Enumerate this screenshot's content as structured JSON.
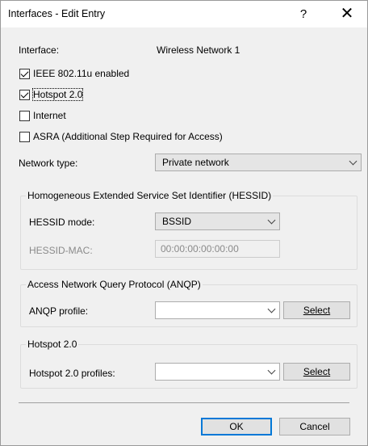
{
  "window": {
    "title": "Interfaces - Edit Entry",
    "help_glyph": "?",
    "close_glyph": "✕"
  },
  "interface": {
    "label": "Interface:",
    "value": "Wireless Network 1"
  },
  "checkboxes": [
    {
      "label": "IEEE 802.11u enabled",
      "checked": true
    },
    {
      "label": "Hotspot 2.0",
      "checked": true
    },
    {
      "label": "Internet",
      "checked": false
    },
    {
      "label": "ASRA (Additional Step Required for Access)",
      "checked": false
    }
  ],
  "network_type": {
    "label": "Network type:",
    "value": "Private network"
  },
  "hessid_group": {
    "title": "Homogeneous Extended Service Set Identifier (HESSID)",
    "mode_label": "HESSID mode:",
    "mode_value": "BSSID",
    "mac_label": "HESSID-MAC:",
    "mac_value": "00:00:00:00:00:00"
  },
  "anqp_group": {
    "title": "Access Network Query Protocol (ANQP)",
    "profile_label": "ANQP profile:",
    "profile_value": "",
    "select_label": "Select"
  },
  "hotspot_group": {
    "title": "Hotspot 2.0",
    "profiles_label": "Hotspot 2.0 profiles:",
    "profiles_value": "",
    "select_label": "Select"
  },
  "footer": {
    "ok_label": "OK",
    "cancel_label": "Cancel"
  }
}
